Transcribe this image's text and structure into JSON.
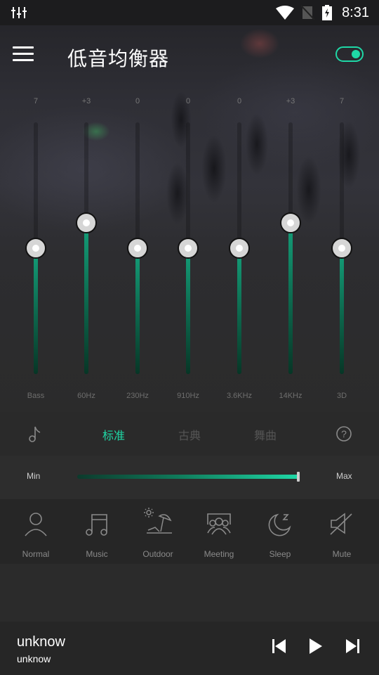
{
  "status_bar": {
    "time": "8:31",
    "icons": [
      "equalizer-notification-icon",
      "wifi-icon",
      "no-sim-icon",
      "battery-charging-icon"
    ]
  },
  "app_bar": {
    "title": "低音均衡器",
    "menu_icon": "hamburger-menu-icon",
    "toggle": {
      "state": "on",
      "accent": "#1fd8a6"
    }
  },
  "equalizer": {
    "accent": "#14a07a",
    "bands": [
      {
        "label": "Bass",
        "value_text": "7",
        "level": 0.5
      },
      {
        "label": "60Hz",
        "value_text": "+3",
        "level": 0.6
      },
      {
        "label": "230Hz",
        "value_text": "0",
        "level": 0.5
      },
      {
        "label": "910Hz",
        "value_text": "0",
        "level": 0.5
      },
      {
        "label": "3.6KHz",
        "value_text": "0",
        "level": 0.5
      },
      {
        "label": "14KHz",
        "value_text": "+3",
        "level": 0.6
      },
      {
        "label": "3D",
        "value_text": "7",
        "level": 0.5
      }
    ]
  },
  "presets": {
    "left_icon": "music-note-icon",
    "tabs": [
      {
        "label": "标准",
        "active": true
      },
      {
        "label": "古典",
        "active": false
      },
      {
        "label": "舞曲",
        "active": false
      }
    ],
    "right_icon": "help-icon"
  },
  "volume": {
    "min_label": "Min",
    "max_label": "Max",
    "level": 1.0
  },
  "modes": [
    {
      "label": "Normal",
      "icon": "person-icon"
    },
    {
      "label": "Music",
      "icon": "music-notes-icon"
    },
    {
      "label": "Outdoor",
      "icon": "beach-umbrella-icon"
    },
    {
      "label": "Meeting",
      "icon": "meeting-group-icon"
    },
    {
      "label": "Sleep",
      "icon": "moon-sleep-icon"
    },
    {
      "label": "Mute",
      "icon": "speaker-mute-icon"
    }
  ],
  "player": {
    "title": "unknow",
    "artist": "unknow",
    "controls": [
      "previous-icon",
      "play-icon",
      "next-icon"
    ]
  }
}
